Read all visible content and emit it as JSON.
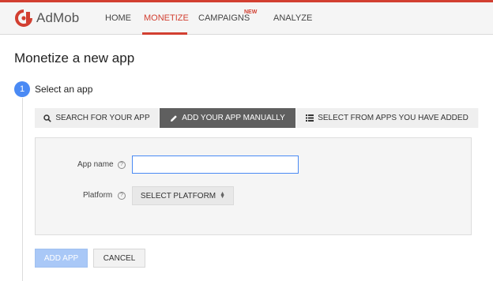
{
  "app": {
    "name": "AdMob",
    "brand_color": "#d23f31",
    "accent_color": "#4a8af4"
  },
  "nav": {
    "items": [
      {
        "label": "HOME",
        "active": false
      },
      {
        "label": "MONETIZE",
        "active": true
      },
      {
        "label": "CAMPAIGNS",
        "active": false,
        "badge": "NEW"
      },
      {
        "label": "ANALYZE",
        "active": false
      }
    ]
  },
  "page": {
    "title": "Monetize a new app"
  },
  "step": {
    "number": "1",
    "label": "Select an app"
  },
  "tabs": [
    {
      "label": "SEARCH FOR YOUR APP",
      "icon": "search-icon",
      "active": false
    },
    {
      "label": "ADD YOUR APP MANUALLY",
      "icon": "pencil-icon",
      "active": true
    },
    {
      "label": "SELECT FROM APPS YOU HAVE ADDED",
      "icon": "list-icon",
      "active": false
    }
  ],
  "form": {
    "app_name_label": "App name",
    "app_name_value": "",
    "platform_label": "Platform",
    "platform_value": "SELECT PLATFORM",
    "help_glyph": "?"
  },
  "actions": {
    "add_app": "ADD APP",
    "cancel": "CANCEL"
  }
}
